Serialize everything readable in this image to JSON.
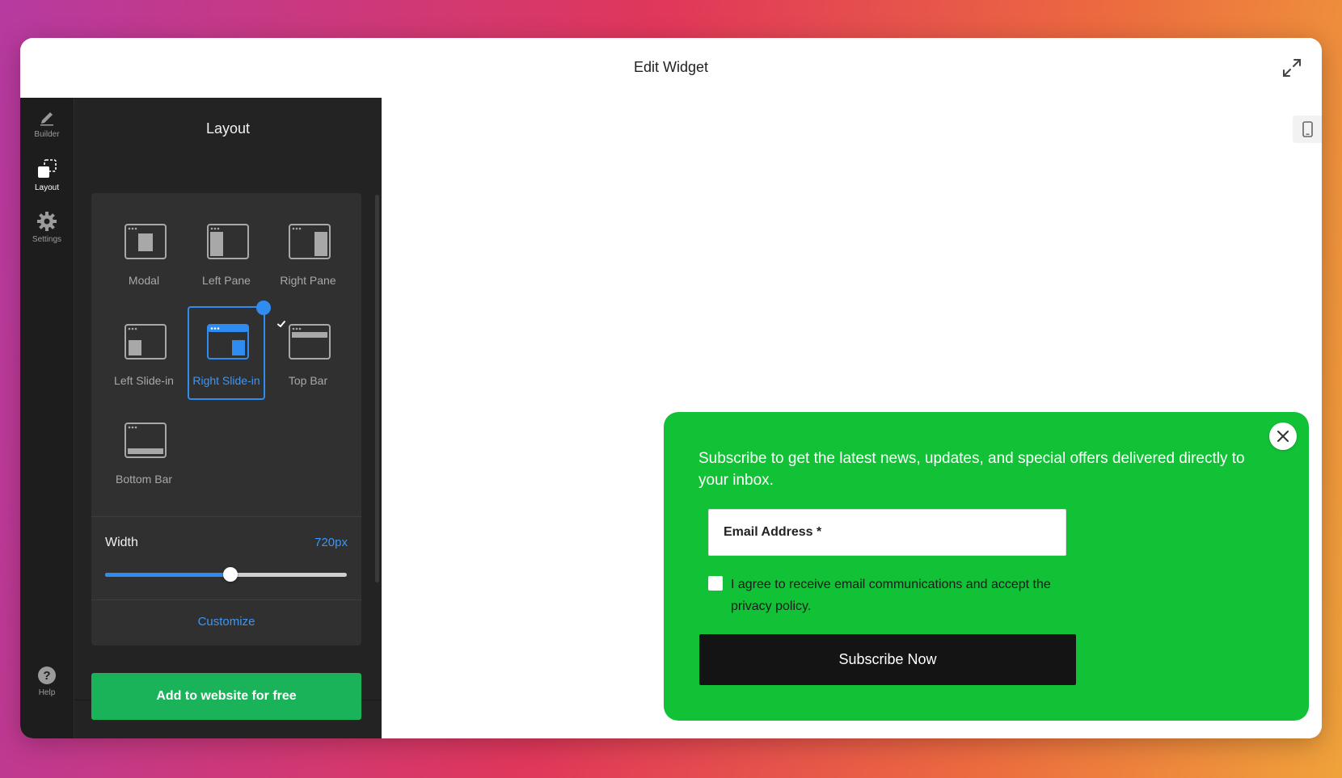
{
  "window": {
    "title": "Edit Widget"
  },
  "rail": {
    "items": [
      {
        "label": "Builder",
        "icon": "pencil-icon"
      },
      {
        "label": "Layout",
        "icon": "layout-icon"
      },
      {
        "label": "Settings",
        "icon": "gear-icon"
      }
    ],
    "help_label": "Help",
    "active": "Layout"
  },
  "panel": {
    "title": "Layout",
    "layouts": [
      {
        "label": "Modal"
      },
      {
        "label": "Left Pane"
      },
      {
        "label": "Right Pane"
      },
      {
        "label": "Left Slide-in"
      },
      {
        "label": "Right Slide-in",
        "selected": true
      },
      {
        "label": "Top Bar"
      },
      {
        "label": "Bottom Bar"
      }
    ],
    "width": {
      "label": "Width",
      "value": "720px",
      "slider_fraction": 0.52
    },
    "customize_label": "Customize",
    "add_button_label": "Add to website for free"
  },
  "widget": {
    "message": "Subscribe to get the latest news, updates, and special offers delivered directly to your inbox.",
    "email_placeholder": "Email Address *",
    "consent_text": "I agree to receive email communications and accept the privacy policy.",
    "submit_label": "Subscribe Now"
  },
  "colors": {
    "accent": "#2f8cf0",
    "widget_bg": "#12c236",
    "add_button": "#1bb35a",
    "panel_bg": "#232323"
  }
}
